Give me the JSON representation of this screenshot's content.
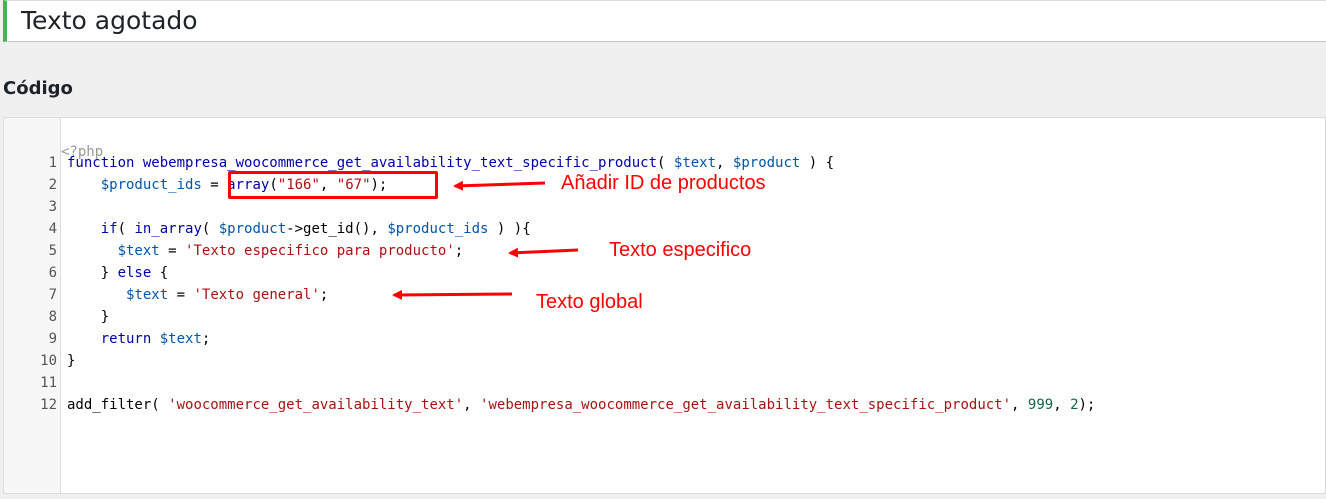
{
  "title_field": {
    "value": "Texto agotado"
  },
  "section": {
    "heading": "Código"
  },
  "editor": {
    "open_tag": "<?php",
    "lines": [
      {
        "num": "1",
        "tokens": [
          {
            "t": "function",
            "c": "kw"
          },
          {
            "t": " ",
            "c": ""
          },
          {
            "t": "webempresa_woocommerce_get_availability_text_specific_product",
            "c": "kw"
          },
          {
            "t": "( ",
            "c": ""
          },
          {
            "t": "$text",
            "c": "var"
          },
          {
            "t": ", ",
            "c": ""
          },
          {
            "t": "$product",
            "c": "var"
          },
          {
            "t": " ) {",
            "c": ""
          }
        ]
      },
      {
        "num": "2",
        "tokens": [
          {
            "t": "    ",
            "c": ""
          },
          {
            "t": "$product_ids",
            "c": "var"
          },
          {
            "t": " = ",
            "c": ""
          },
          {
            "t": "array",
            "c": "kw"
          },
          {
            "t": "(",
            "c": ""
          },
          {
            "t": "\"166\"",
            "c": "str"
          },
          {
            "t": ", ",
            "c": ""
          },
          {
            "t": "\"67\"",
            "c": "str"
          },
          {
            "t": ");",
            "c": ""
          }
        ]
      },
      {
        "num": "3",
        "tokens": []
      },
      {
        "num": "4",
        "tokens": [
          {
            "t": "    ",
            "c": ""
          },
          {
            "t": "if",
            "c": "kw"
          },
          {
            "t": "( ",
            "c": ""
          },
          {
            "t": "in_array",
            "c": "kw"
          },
          {
            "t": "( ",
            "c": ""
          },
          {
            "t": "$product",
            "c": "var"
          },
          {
            "t": "->get_id(), ",
            "c": ""
          },
          {
            "t": "$product_ids",
            "c": "var"
          },
          {
            "t": " ) ){",
            "c": ""
          }
        ]
      },
      {
        "num": "5",
        "tokens": [
          {
            "t": "      ",
            "c": ""
          },
          {
            "t": "$text",
            "c": "var"
          },
          {
            "t": " = ",
            "c": ""
          },
          {
            "t": "'Texto especifico para producto'",
            "c": "str"
          },
          {
            "t": ";",
            "c": ""
          }
        ]
      },
      {
        "num": "6",
        "tokens": [
          {
            "t": "    } ",
            "c": ""
          },
          {
            "t": "else",
            "c": "kw"
          },
          {
            "t": " {",
            "c": ""
          }
        ]
      },
      {
        "num": "7",
        "tokens": [
          {
            "t": "       ",
            "c": ""
          },
          {
            "t": "$text",
            "c": "var"
          },
          {
            "t": " = ",
            "c": ""
          },
          {
            "t": "'Texto general'",
            "c": "str"
          },
          {
            "t": ";",
            "c": ""
          }
        ]
      },
      {
        "num": "8",
        "tokens": [
          {
            "t": "    }",
            "c": ""
          }
        ]
      },
      {
        "num": "9",
        "tokens": [
          {
            "t": "    ",
            "c": ""
          },
          {
            "t": "return",
            "c": "kw"
          },
          {
            "t": " ",
            "c": ""
          },
          {
            "t": "$text",
            "c": "var"
          },
          {
            "t": ";",
            "c": ""
          }
        ]
      },
      {
        "num": "10",
        "tokens": [
          {
            "t": "}",
            "c": ""
          }
        ]
      },
      {
        "num": "11",
        "tokens": []
      },
      {
        "num": "12",
        "tokens": [
          {
            "t": "add_filter( ",
            "c": ""
          },
          {
            "t": "'woocommerce_get_availability_text'",
            "c": "str"
          },
          {
            "t": ", ",
            "c": ""
          },
          {
            "t": "'webempresa_woocommerce_get_availability_text_specific_product'",
            "c": "str"
          },
          {
            "t": ", ",
            "c": ""
          },
          {
            "t": "999",
            "c": "num"
          },
          {
            "t": ", ",
            "c": ""
          },
          {
            "t": "2",
            "c": "num"
          },
          {
            "t": ");",
            "c": ""
          }
        ]
      }
    ]
  },
  "annotations": {
    "add_ids": "Añadir ID de productos",
    "specific_text": "Texto especifico",
    "global_text": "Texto global",
    "color": "#ff0000"
  }
}
